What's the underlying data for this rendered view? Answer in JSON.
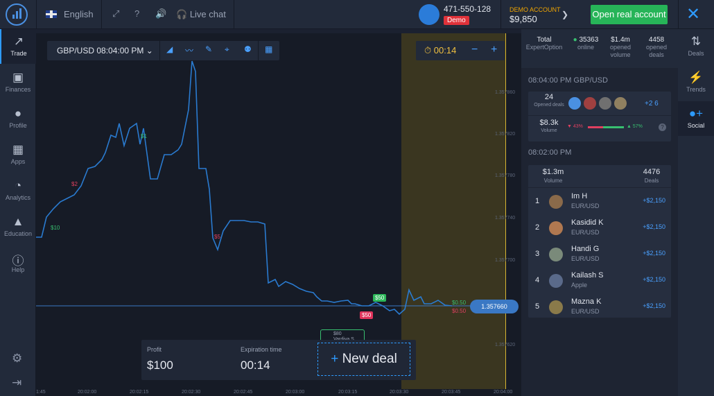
{
  "header": {
    "language": "English",
    "live_chat": "Live chat",
    "account_number": "471-550-128",
    "account_badge": "Demo",
    "demo_label": "DEMO ACCOUNT",
    "balance": "$9,850",
    "open_real": "Open real account"
  },
  "leftnav": [
    {
      "label": "Trade",
      "icon": "trend-icon"
    },
    {
      "label": "Finances",
      "icon": "wallet-icon"
    },
    {
      "label": "Profile",
      "icon": "user-icon"
    },
    {
      "label": "Apps",
      "icon": "grid-icon"
    },
    {
      "label": "Analytics",
      "icon": "pie-icon"
    },
    {
      "label": "Education",
      "icon": "graduation-icon"
    },
    {
      "label": "Help",
      "icon": "info-icon"
    }
  ],
  "toolbar": {
    "pair": "GBP/USD 08:04:00 PM",
    "timer": "00:14"
  },
  "chart_data": {
    "type": "line",
    "y_ticks": [
      "1.357860",
      "1.357820",
      "1.357780",
      "1.357740",
      "1.357700",
      "1.357660",
      "1.357620"
    ],
    "x_ticks": [
      "1:45",
      "20:02:00",
      "20:02:15",
      "20:02:30",
      "20:02:45",
      "20:03:00",
      "20:03:15",
      "20:03:30",
      "20:03:45",
      "20:04:00"
    ],
    "current_price": "1.357660"
  },
  "markers": {
    "m1": "$1",
    "m2": "$10",
    "m3": "$2",
    "m4": "$80",
    "m5": "$50",
    "m6": "$50",
    "m7": "$0.50",
    "m8": "$0.50",
    "m9": "$0",
    "m10": "$5",
    "m11": "Vardiya S"
  },
  "deal": {
    "profit_label": "Profit",
    "profit": "$100",
    "exp_label": "Expiration time",
    "exp": "00:14",
    "new_deal": "New deal"
  },
  "social": {
    "stats": [
      {
        "value": "Total",
        "label": "ExpertOption"
      },
      {
        "value": "35363",
        "label": "online"
      },
      {
        "value": "$1.4m",
        "label": "opened volume"
      },
      {
        "value": "4458",
        "label": "opened deals"
      }
    ],
    "sec1": "08:04:00 PM GBP/USD",
    "opened_deals": "24",
    "opened_deals_label": "Opened deals",
    "more_users": "+2 6",
    "volume": "$8.3k",
    "volume_label": "Volume",
    "down_pct": "43%",
    "up_pct": "57%",
    "sec2": "08:02:00 PM",
    "lb_volume": "$1.3m",
    "lb_volume_label": "Volume",
    "lb_deals": "4476",
    "lb_deals_label": "Deals",
    "leaders": [
      {
        "rank": "1",
        "name": "Im H",
        "asset": "EUR/USD",
        "amount": "+$2,150"
      },
      {
        "rank": "2",
        "name": "Kasidid K",
        "asset": "EUR/USD",
        "amount": "+$2,150"
      },
      {
        "rank": "3",
        "name": "Handi G",
        "asset": "EUR/USD",
        "amount": "+$2,150"
      },
      {
        "rank": "4",
        "name": "Kailash S",
        "asset": "Apple",
        "amount": "+$2,150"
      },
      {
        "rank": "5",
        "name": "Mazna K",
        "asset": "EUR/USD",
        "amount": "+$2,150"
      }
    ]
  },
  "rightnav": [
    {
      "label": "Deals",
      "icon": "sort-icon"
    },
    {
      "label": "Trends",
      "icon": "bolt-icon"
    },
    {
      "label": "Social",
      "icon": "add-user-icon"
    }
  ]
}
